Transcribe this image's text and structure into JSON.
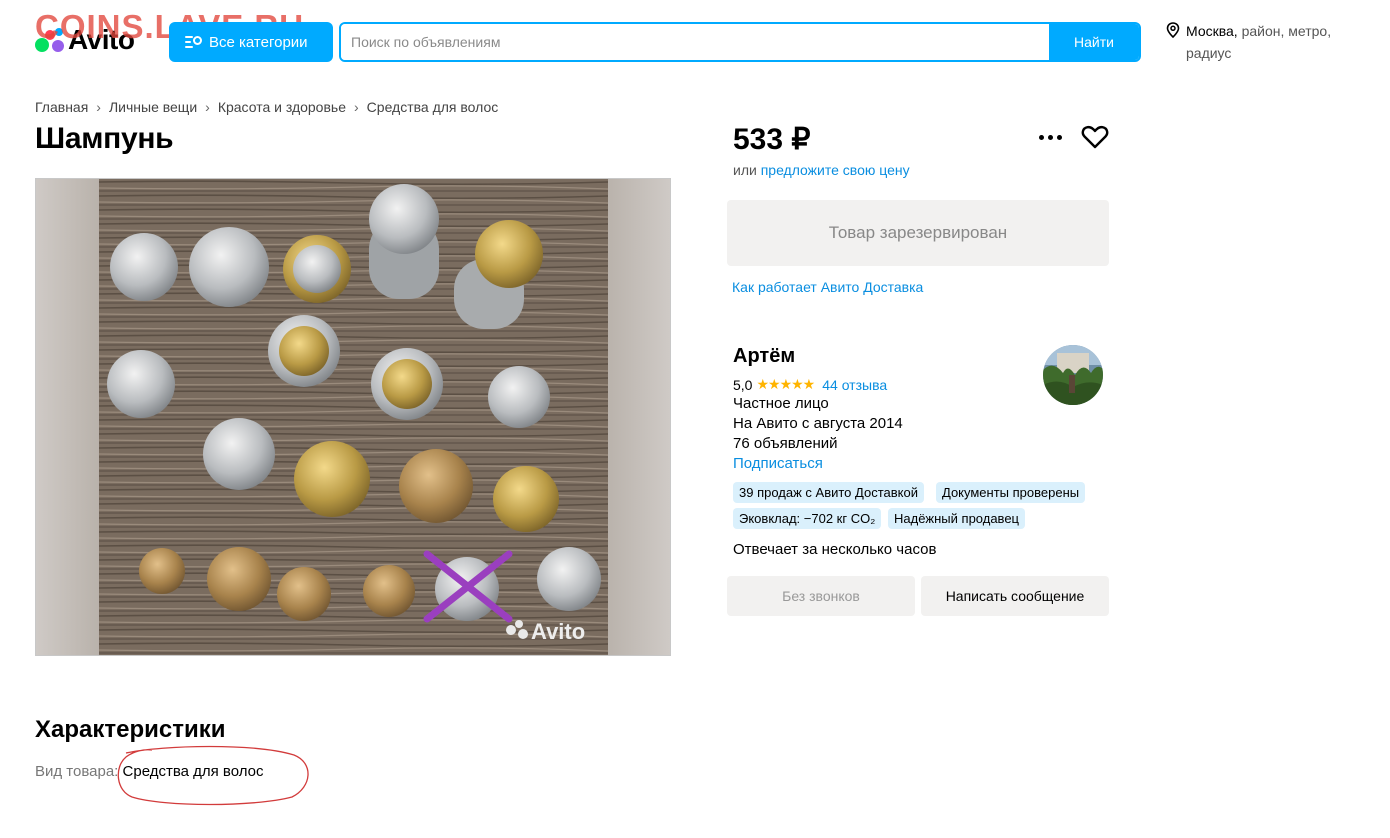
{
  "watermark": "COINS.LAVE.RU",
  "logo": {
    "text": "Avito"
  },
  "header": {
    "categories_label": "Все категории",
    "search_placeholder": "Поиск по объявлениям",
    "search_button": "Найти",
    "location_city": "Москва,",
    "location_rest": " район, метро,",
    "location_line2": "радиус"
  },
  "breadcrumb": [
    "Главная",
    "Личные вещи",
    "Красота и здоровье",
    "Средства для волос"
  ],
  "listing": {
    "title": "Шампунь",
    "price": "533 ₽",
    "offer_prefix": "или ",
    "offer_link": "предложите свою цену",
    "reserved_label": "Товар зарезервирован",
    "delivery_link": "Как работает Авито Доставка",
    "photo_watermark": "Avito"
  },
  "seller": {
    "name": "Артём",
    "rating": "5,0",
    "stars": "★★★★★",
    "reviews": "44 отзыва",
    "type": "Частное лицо",
    "since": "На Авито с августа 2014",
    "listings": "76 объявлений",
    "subscribe": "Подписаться",
    "badges": [
      "39 продаж с Авито Доставкой",
      "Документы проверены",
      "Эковклад: −702 кг CO₂",
      "Надёжный продавец"
    ],
    "response_time": "Отвечает за несколько часов",
    "no_calls": "Без звонков",
    "write_message": "Написать сообщение"
  },
  "characteristics": {
    "title": "Характеристики",
    "key": "Вид товара: ",
    "value": "Средства для волос"
  },
  "colors": {
    "accent": "#00aaff",
    "link": "#0a8ee0",
    "star": "#ffb400",
    "badge_bg": "#daf0fc",
    "button_bg": "#f2f1f0"
  }
}
